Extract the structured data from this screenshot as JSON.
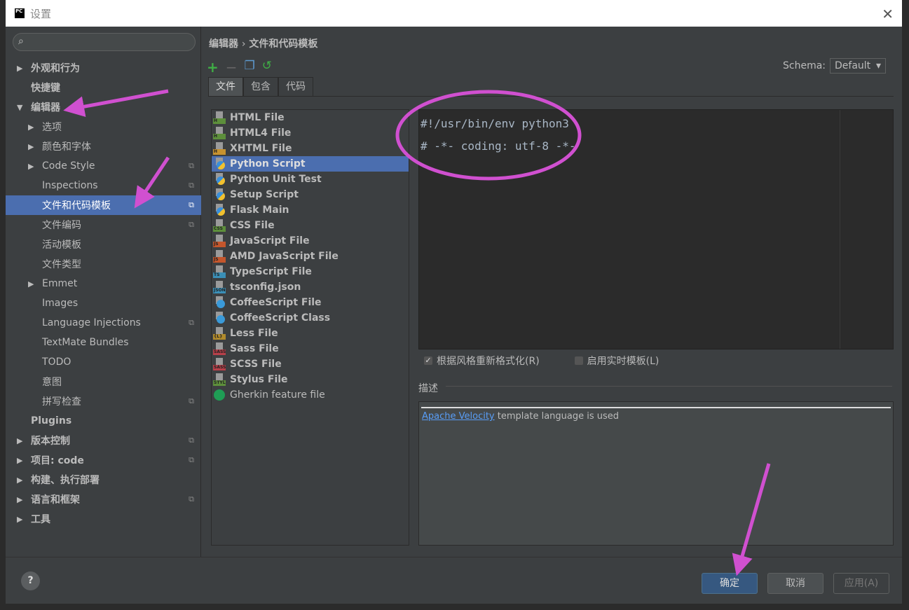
{
  "window": {
    "title": "设置",
    "logo": "PC"
  },
  "sidebar": {
    "search_placeholder": "",
    "items": [
      {
        "label": "外观和行为",
        "arrow": "▶",
        "bold": true,
        "level": 0
      },
      {
        "label": "快捷键",
        "arrow": "",
        "bold": true,
        "level": 0
      },
      {
        "label": "编辑器",
        "arrow": "▼",
        "bold": true,
        "level": 0
      },
      {
        "label": "选项",
        "arrow": "▶",
        "level": 1
      },
      {
        "label": "颜色和字体",
        "arrow": "▶",
        "level": 1
      },
      {
        "label": "Code Style",
        "arrow": "▶",
        "level": 1,
        "copy": true
      },
      {
        "label": "Inspections",
        "arrow": "",
        "level": 1,
        "copy": true
      },
      {
        "label": "文件和代码模板",
        "arrow": "",
        "level": 1,
        "copy": true,
        "selected": true
      },
      {
        "label": "文件编码",
        "arrow": "",
        "level": 1,
        "copy": true
      },
      {
        "label": "活动模板",
        "arrow": "",
        "level": 1
      },
      {
        "label": "文件类型",
        "arrow": "",
        "level": 1
      },
      {
        "label": "Emmet",
        "arrow": "▶",
        "level": 1
      },
      {
        "label": "Images",
        "arrow": "",
        "level": 1
      },
      {
        "label": "Language Injections",
        "arrow": "",
        "level": 1,
        "copy": true
      },
      {
        "label": "TextMate Bundles",
        "arrow": "",
        "level": 1
      },
      {
        "label": "TODO",
        "arrow": "",
        "level": 1
      },
      {
        "label": "意图",
        "arrow": "",
        "level": 1
      },
      {
        "label": "拼写检查",
        "arrow": "",
        "level": 1,
        "copy": true
      },
      {
        "label": "Plugins",
        "arrow": "",
        "bold": true,
        "level": 0
      },
      {
        "label": "版本控制",
        "arrow": "▶",
        "bold": true,
        "level": 0,
        "copy": true
      },
      {
        "label": "项目: code",
        "arrow": "▶",
        "bold": true,
        "level": 0,
        "copy": true
      },
      {
        "label": "构建、执行部署",
        "arrow": "▶",
        "bold": true,
        "level": 0
      },
      {
        "label": "语言和框架",
        "arrow": "▶",
        "bold": true,
        "level": 0,
        "copy": true
      },
      {
        "label": "工具",
        "arrow": "▶",
        "bold": true,
        "level": 0
      }
    ]
  },
  "breadcrumb": {
    "parent": "编辑器",
    "sep": "›",
    "current": "文件和代码模板"
  },
  "toolbar": {
    "add": "+",
    "remove": "−",
    "copy": "copy-icon",
    "reset": "reset-icon"
  },
  "tabs": [
    "文件",
    "包含",
    "代码"
  ],
  "schema": {
    "label": "Schema:",
    "value": "Default"
  },
  "files": [
    {
      "name": "HTML File",
      "tag": "H",
      "color": "#5d8f3b"
    },
    {
      "name": "HTML4 File",
      "tag": "H",
      "color": "#5d8f3b"
    },
    {
      "name": "XHTML File",
      "tag": "H",
      "color": "#c7922f"
    },
    {
      "name": "Python Script",
      "icon": "python",
      "selected": true
    },
    {
      "name": "Python Unit Test",
      "icon": "python"
    },
    {
      "name": "Setup Script",
      "icon": "python"
    },
    {
      "name": "Flask Main",
      "icon": "python"
    },
    {
      "name": "CSS File",
      "tag": "CSS",
      "color": "#5d8f3b"
    },
    {
      "name": "JavaScript File",
      "tag": "JS",
      "color": "#c4562c"
    },
    {
      "name": "AMD JavaScript File",
      "tag": "JS",
      "color": "#c4562c"
    },
    {
      "name": "TypeScript File",
      "tag": "TS",
      "color": "#3a8fb7"
    },
    {
      "name": "tsconfig.json",
      "tag": "JSON",
      "color": "#3a8fb7"
    },
    {
      "name": "CoffeeScript File",
      "icon": "coffee"
    },
    {
      "name": "CoffeeScript Class",
      "icon": "coffee"
    },
    {
      "name": "Less File",
      "tag": "{L}",
      "color": "#b08a2c"
    },
    {
      "name": "Sass File",
      "tag": "SASS",
      "color": "#b8404a"
    },
    {
      "name": "SCSS File",
      "tag": "SASS",
      "color": "#b8404a"
    },
    {
      "name": "Stylus File",
      "tag": "STYL",
      "color": "#5d8f3b"
    },
    {
      "name": "Gherkin feature file",
      "icon": "gherkin",
      "plain": true
    }
  ],
  "editor": {
    "lines": [
      "#!/usr/bin/env python3",
      "# -*- coding: utf-8 -*-"
    ]
  },
  "options": {
    "reformat": {
      "label": "根据风格重新格式化(R)",
      "checked": true
    },
    "live": {
      "label": "启用实时模板(L)",
      "checked": false
    }
  },
  "description": {
    "label": "描述",
    "link": "Apache Velocity",
    "text": " template language is used"
  },
  "buttons": {
    "help": "?",
    "ok": "确定",
    "cancel": "取消",
    "apply": "应用(A)"
  },
  "colors": {
    "accent": "#4b6eaf",
    "annotation": "#d050d0"
  }
}
